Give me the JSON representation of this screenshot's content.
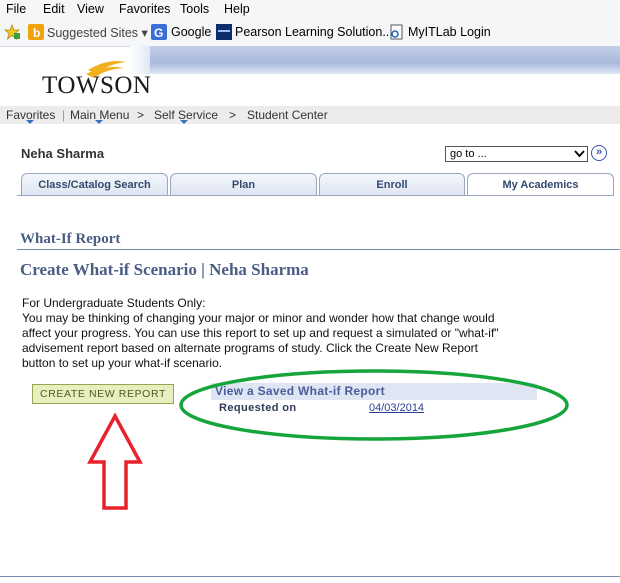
{
  "browser": {
    "menu": [
      "File",
      "Edit",
      "View",
      "Favorites",
      "Tools",
      "Help"
    ],
    "favorites": [
      {
        "label": "Suggested Sites ▾",
        "icon": "suggested-sites-icon"
      },
      {
        "label": "Google",
        "icon": "google-icon"
      },
      {
        "label": "Pearson Learning Solution...",
        "icon": "pearson-icon"
      },
      {
        "label": "MyITLab Login",
        "icon": "page-icon"
      }
    ]
  },
  "header": {
    "logo": "TOWSON",
    "nav": [
      "Favorites",
      "Main Menu",
      ">",
      "Self Service",
      ">",
      "Student Center"
    ]
  },
  "student": {
    "name": "Neha Sharma",
    "goto_value": "go to ..."
  },
  "tabs": [
    "Class/Catalog Search",
    "Plan",
    "Enroll",
    "My Academics"
  ],
  "page": {
    "title": "What-If Report",
    "subtitle": "Create What-if Scenario | Neha Sharma",
    "intro_lines": [
      "For Undergraduate Students Only:",
      "You may be thinking of changing your major or minor and wonder how that change would",
      "affect your progress. You can use this report to set up and request a simulated or \"what-if\"",
      "advisement report based on alternate programs of study. Click the Create New Report",
      "button to set up your what-if scenario."
    ],
    "create_button": "Create New Report",
    "saved": {
      "header": "View a Saved What-if Report",
      "label": "Requested on",
      "date": "04/03/2014"
    }
  },
  "colors": {
    "accent": "#4a5d84",
    "annotation_arrow": "#e8212b",
    "annotation_ellipse": "#16a53a"
  }
}
